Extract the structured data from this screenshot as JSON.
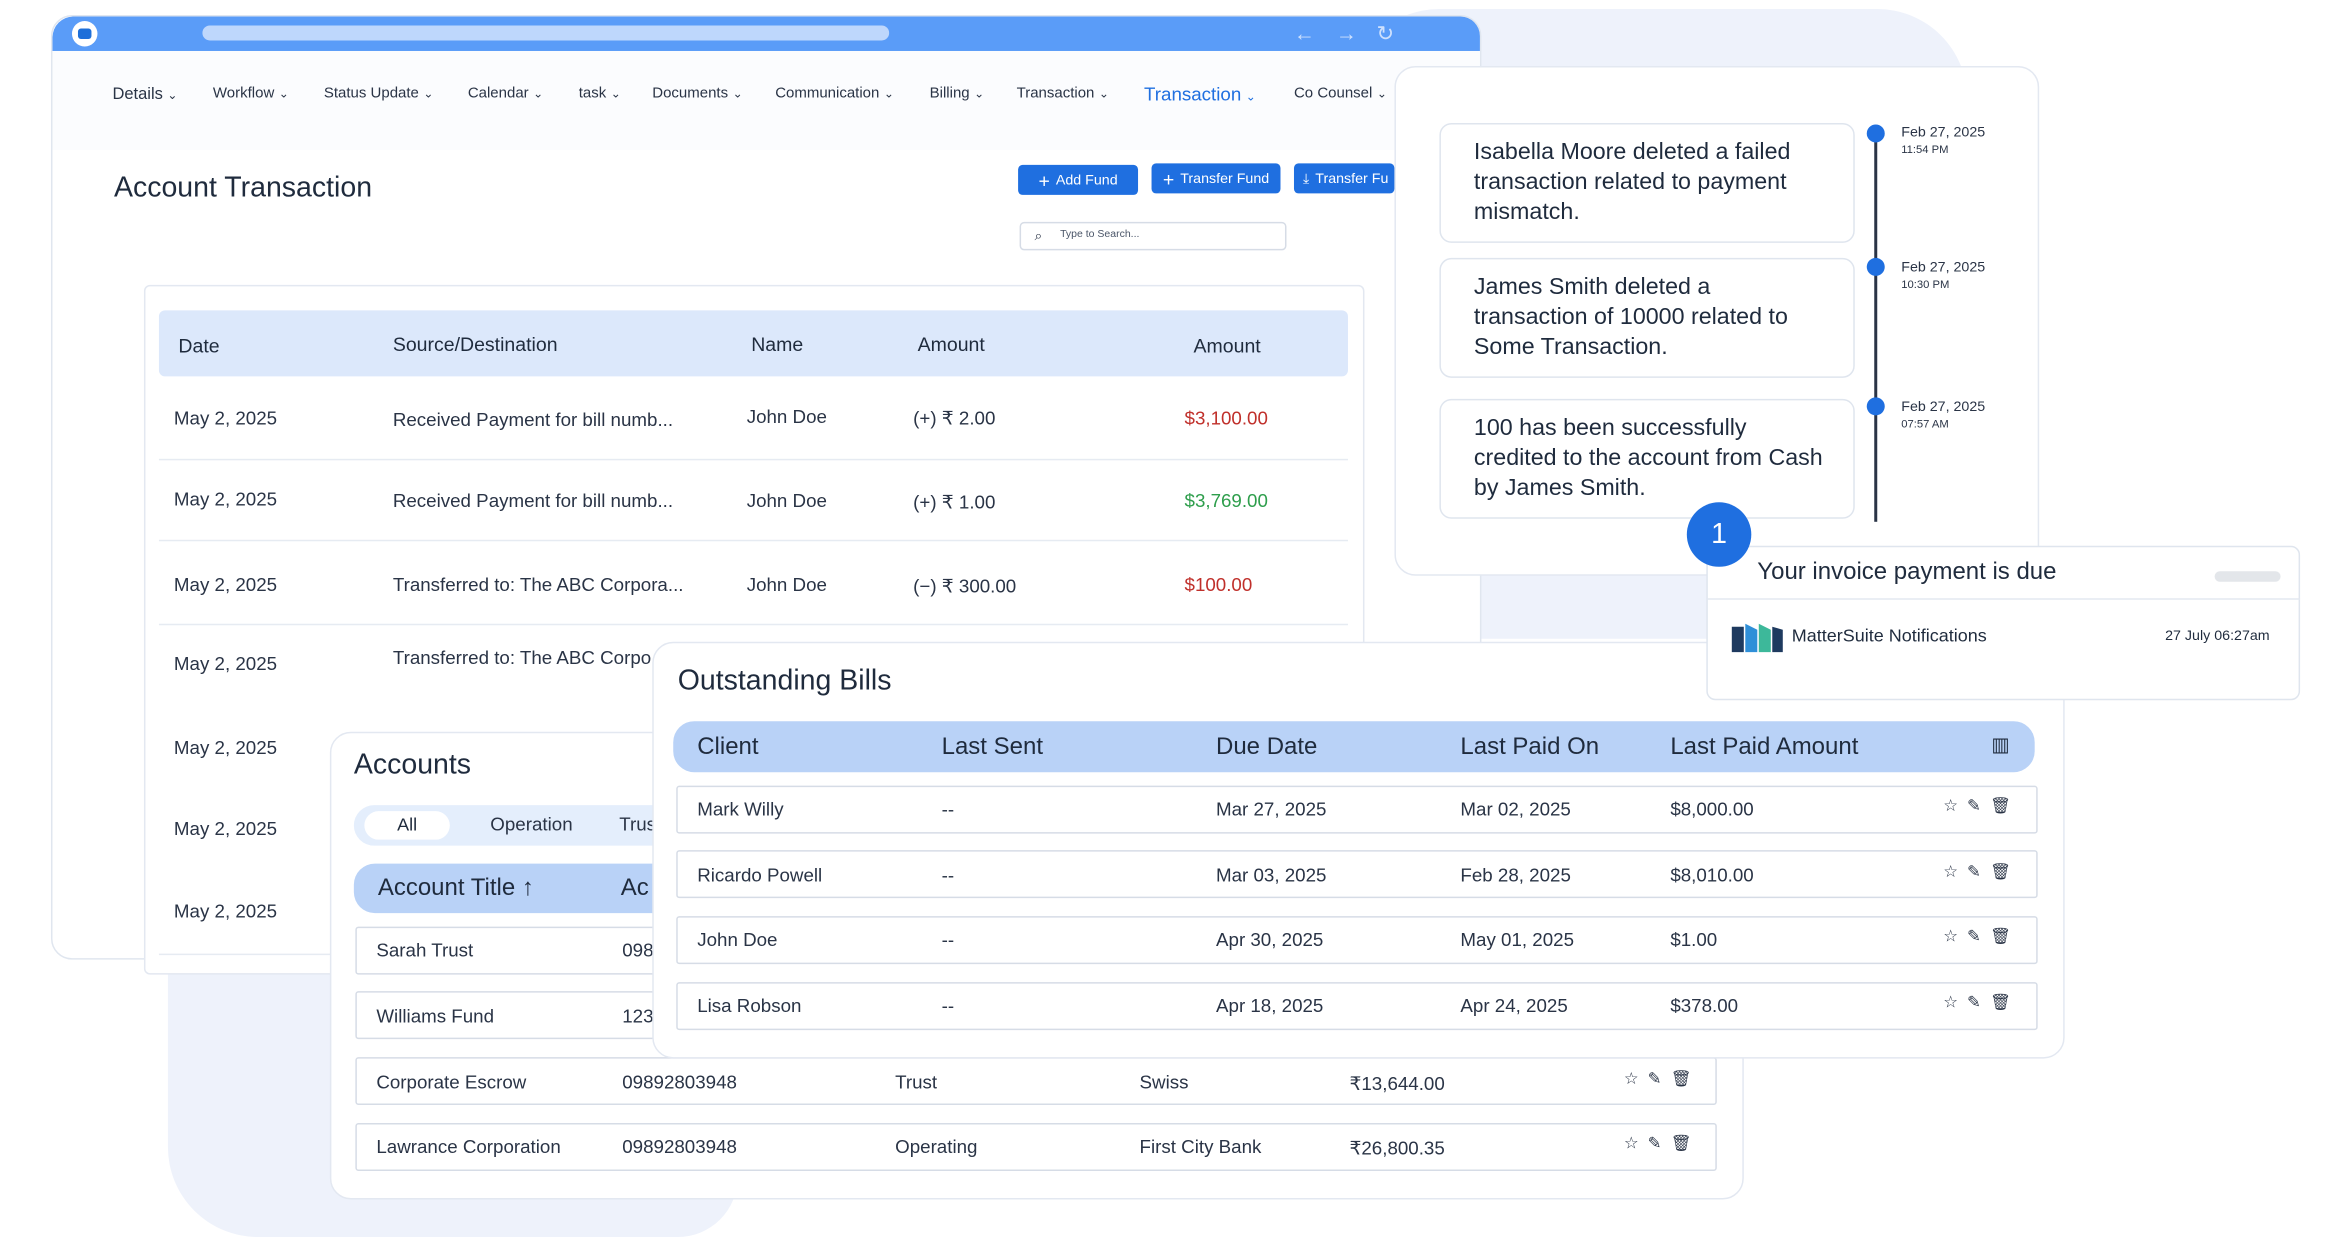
{
  "colors": {
    "accent": "#1f6fe0",
    "negative": "#c0302b",
    "positive": "#2e9e4c",
    "header_blue": "#b9d2f7"
  },
  "menu": {
    "items": [
      {
        "label": "Details",
        "active": false
      },
      {
        "label": "Workflow",
        "active": false
      },
      {
        "label": "Status Update",
        "active": false
      },
      {
        "label": "Calendar",
        "active": false
      },
      {
        "label": "task",
        "active": false
      },
      {
        "label": "Documents",
        "active": false
      },
      {
        "label": "Communication",
        "active": false
      },
      {
        "label": "Billing",
        "active": false
      },
      {
        "label": "Transaction",
        "active": false
      },
      {
        "label": "Transaction",
        "active": true
      },
      {
        "label": "Co Counsel",
        "active": false
      }
    ]
  },
  "page": {
    "title": "Account Transaction"
  },
  "toolbar": {
    "add_fund": "Add Fund",
    "transfer_fund": "Transfer Fund",
    "transfer_fund_2": "Transfer Fu"
  },
  "search": {
    "placeholder": "Type to Search..."
  },
  "transactions": {
    "headers": {
      "date": "Date",
      "source": "Source/Destination",
      "name": "Name",
      "amount": "Amount",
      "amount2": "Amount"
    },
    "rows": [
      {
        "date": "May 2, 2025",
        "source": "Received Payment for bill numb...",
        "name": "John Doe",
        "amount": "(+) ₹ 2.00",
        "amount2": "$3,100.00",
        "amount2_color": "negative"
      },
      {
        "date": "May 2, 2025",
        "source": "Received Payment for bill numb...",
        "name": "John Doe",
        "amount": "(+) ₹ 1.00",
        "amount2": "$3,769.00",
        "amount2_color": "positive"
      },
      {
        "date": "May 2, 2025",
        "source": "Transferred to: The ABC Corpora...",
        "name": "John Doe",
        "amount": "(−) ₹ 300.00",
        "amount2": "$100.00",
        "amount2_color": "negative"
      },
      {
        "date": "May 2, 2025",
        "source": "Transferred to: The ABC Corpo",
        "name": "",
        "amount": "",
        "amount2": ""
      },
      {
        "date": "May 2, 2025",
        "source": "",
        "name": "",
        "amount": "",
        "amount2": ""
      },
      {
        "date": "May 2, 2025",
        "source": "",
        "name": "",
        "amount": "",
        "amount2": ""
      },
      {
        "date": "May 2, 2025",
        "source": "",
        "name": "",
        "amount": "",
        "amount2": ""
      }
    ]
  },
  "accounts": {
    "title": "Accounts",
    "filters": {
      "all": "All",
      "operation": "Operation",
      "trust": "Trus"
    },
    "headers": {
      "title": "Account Title ↑",
      "number": "Ac"
    },
    "rows": [
      {
        "title": "Sarah Trust",
        "number": "098",
        "type": "",
        "bank": "",
        "balance": ""
      },
      {
        "title": "Williams Fund",
        "number": "123",
        "type": "",
        "bank": "",
        "balance": ""
      },
      {
        "title": "Corporate Escrow",
        "number": "09892803948",
        "type": "Trust",
        "bank": "Swiss",
        "balance": "₹13,644.00"
      },
      {
        "title": "Lawrance Corporation",
        "number": "09892803948",
        "type": "Operating",
        "bank": "First City Bank",
        "balance": "₹26,800.35"
      }
    ]
  },
  "outstanding_bills": {
    "title": "Outstanding Bills",
    "headers": {
      "client": "Client",
      "last_sent": "Last Sent",
      "due_date": "Due Date",
      "last_paid_on": "Last Paid On",
      "last_paid_amount": "Last Paid Amount"
    },
    "rows": [
      {
        "client": "Mark Willy",
        "last_sent": "--",
        "due_date": "Mar 27, 2025",
        "last_paid_on": "Mar 02, 2025",
        "amount": "$8,000.00"
      },
      {
        "client": "Ricardo Powell",
        "last_sent": "--",
        "due_date": "Mar 03, 2025",
        "last_paid_on": "Feb 28, 2025",
        "amount": "$8,010.00"
      },
      {
        "client": "John Doe",
        "last_sent": "--",
        "due_date": "Apr 30, 2025",
        "last_paid_on": "May 01, 2025",
        "amount": "$1.00"
      },
      {
        "client": "Lisa Robson",
        "last_sent": "--",
        "due_date": "Apr 18, 2025",
        "last_paid_on": "Apr 24, 2025",
        "amount": "$378.00"
      }
    ],
    "row_icons": [
      "star-icon",
      "pencil-icon",
      "trash-icon"
    ]
  },
  "activity": {
    "items": [
      {
        "text": "Isabella Moore deleted a failed transaction related to payment mismatch.",
        "date": "Feb 27, 2025",
        "time": "11:54 PM"
      },
      {
        "text": "James Smith deleted a transaction of 10000 related to Some Transaction.",
        "date": "Feb 27, 2025",
        "time": "10:30 PM"
      },
      {
        "text": "100 has been successfully credited to the account from Cash by James Smith.",
        "date": "Feb 27, 2025",
        "time": "07:57 AM"
      }
    ]
  },
  "badge": {
    "count": "1"
  },
  "notification": {
    "title": "Your invoice payment is due",
    "source": "MatterSuite Notifications",
    "time": "27 July 06:27am"
  }
}
